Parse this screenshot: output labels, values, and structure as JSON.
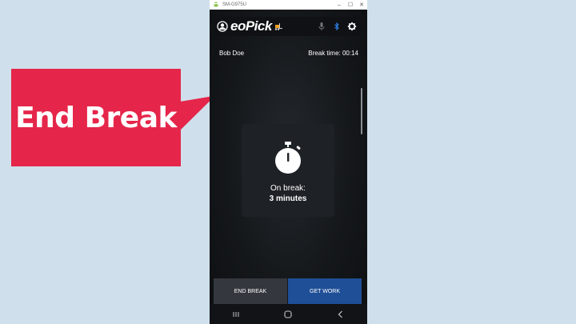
{
  "callout": {
    "text": "End Break",
    "color": "#e5264a"
  },
  "window": {
    "title": "SM-G975U",
    "controls": [
      "–",
      "☐",
      "✕"
    ]
  },
  "app": {
    "logo_text": "eoPick",
    "header_icons": [
      "user-circle-icon",
      "forklift-icon",
      "mic-icon",
      "bluetooth-icon",
      "gear-icon"
    ]
  },
  "user": {
    "name": "Bob Doe",
    "break_time": "Break time: 00:14"
  },
  "break_card": {
    "icon": "stopwatch-icon",
    "label": "On break:",
    "value": "3 minutes"
  },
  "buttons": {
    "end_break": "END BREAK",
    "get_work": "GET WORK"
  },
  "colors": {
    "accent_blue": "#1f4f96",
    "button_gray": "#34383e",
    "bluetooth_blue": "#2e7de0"
  },
  "navbar": [
    "recents-icon",
    "home-icon",
    "back-icon"
  ]
}
